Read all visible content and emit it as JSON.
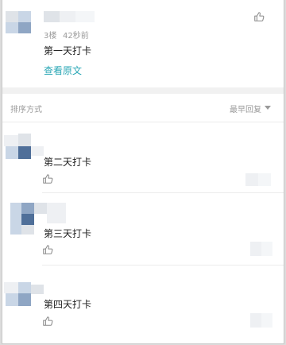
{
  "first_reply": {
    "floor": "3楼",
    "time": "42秒前",
    "content": "第一天打卡",
    "view_original": "查看原文"
  },
  "sort": {
    "label": "排序方式",
    "current": "最早回复"
  },
  "replies": [
    {
      "content": "第二天打卡"
    },
    {
      "content": "第三天打卡"
    },
    {
      "content": "第四天打卡"
    }
  ],
  "icons": {
    "like": "thumbs-up-icon",
    "dropdown": "caret-down-icon"
  }
}
